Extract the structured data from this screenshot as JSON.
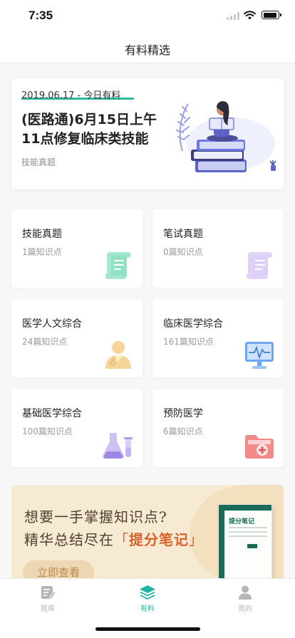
{
  "status_bar": {
    "time": "7:35"
  },
  "nav": {
    "title": "有料精选"
  },
  "featured": {
    "date_label": "2019.06.17 - 今日有料",
    "title": "(医路通)6月15日上午11点修复临床类技能",
    "tag": "技能真题"
  },
  "categories": [
    {
      "name": "技能真题",
      "count": "1篇知识点",
      "icon": "document-icon",
      "color": "#5fd4a8"
    },
    {
      "name": "笔试真题",
      "count": "0篇知识点",
      "icon": "notes-icon",
      "color": "#c9b8f2"
    },
    {
      "name": "医学人文综合",
      "count": "24篇知识点",
      "icon": "doctor-icon",
      "color": "#f6d49a"
    },
    {
      "name": "临床医学综合",
      "count": "161篇知识点",
      "icon": "monitor-icon",
      "color": "#6ea6f1"
    },
    {
      "name": "基础医学综合",
      "count": "100篇知识点",
      "icon": "lab-flask-icon",
      "color": "#c3b1f0"
    },
    {
      "name": "预防医学",
      "count": "6篇知识点",
      "icon": "medical-folder-icon",
      "color": "#f2898b"
    }
  ],
  "promo": {
    "line1": "想要一手掌握知识点?",
    "line2_prefix": "精华总结尽在",
    "bracket_open": "「",
    "highlight": "提分笔记",
    "bracket_close": "」",
    "button_label": "立即查看",
    "book_title": "提分笔记"
  },
  "tab_bar": {
    "items": [
      {
        "label": "题库",
        "icon": "question-bank-icon",
        "active": false
      },
      {
        "label": "有料",
        "icon": "layers-icon",
        "active": true
      },
      {
        "label": "我的",
        "icon": "profile-icon",
        "active": false
      }
    ],
    "active_color": "#1fb4a0",
    "inactive_color": "#b6b6b6"
  }
}
